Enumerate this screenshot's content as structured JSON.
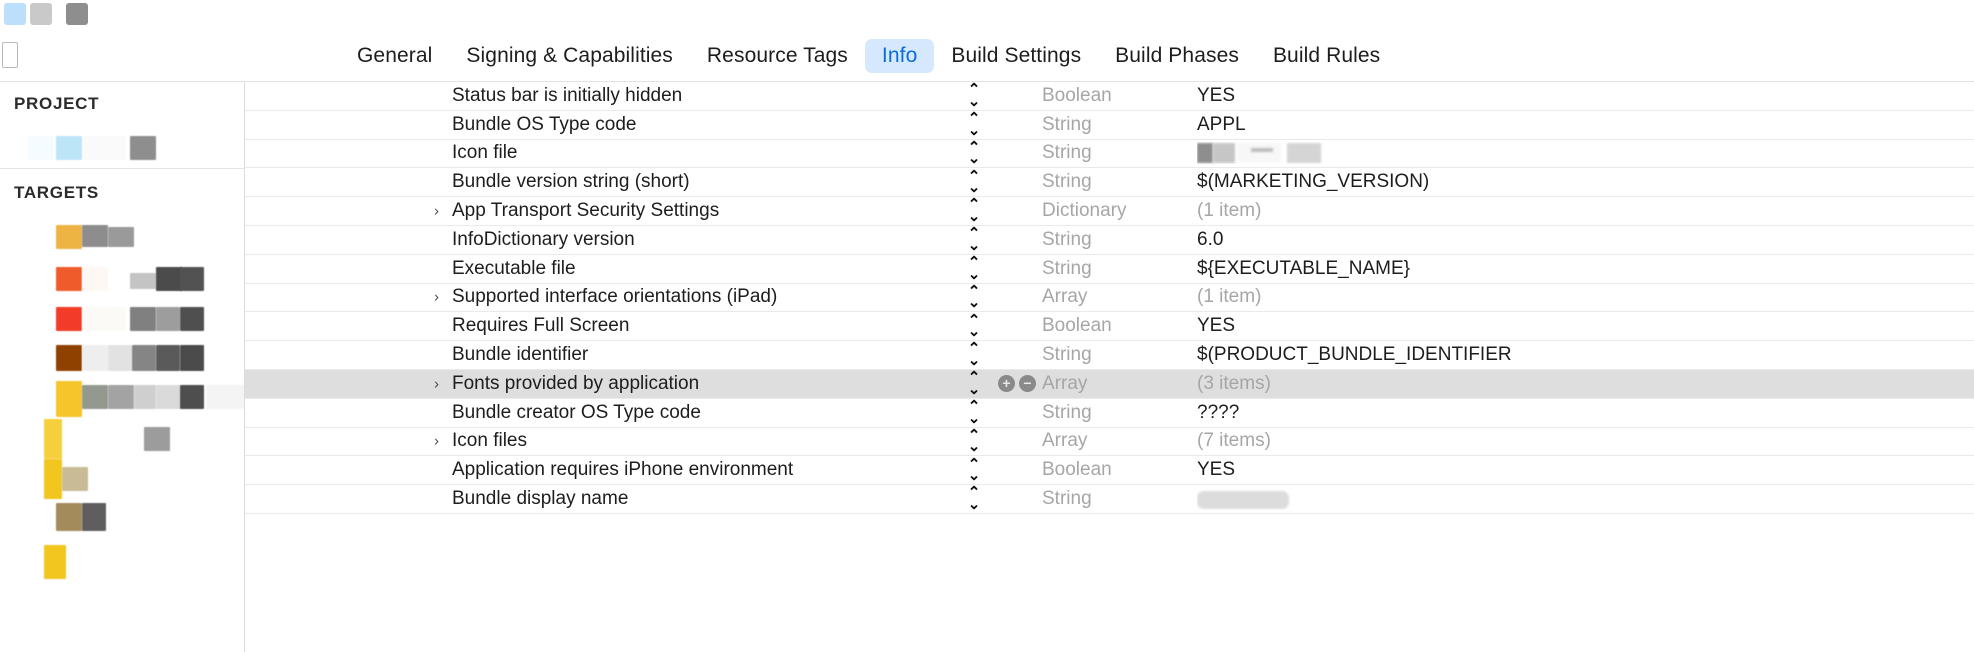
{
  "window": {
    "toolbar_swatches": [
      "#bcdffb",
      "#c9c9c9",
      "#8e8e8e"
    ]
  },
  "tabs": [
    {
      "label": "General",
      "active": false
    },
    {
      "label": "Signing & Capabilities",
      "active": false
    },
    {
      "label": "Resource Tags",
      "active": false
    },
    {
      "label": "Info",
      "active": true
    },
    {
      "label": "Build Settings",
      "active": false
    },
    {
      "label": "Build Phases",
      "active": false
    },
    {
      "label": "Build Rules",
      "active": false
    }
  ],
  "sidebar": {
    "project_header": "PROJECT",
    "targets_header": "TARGETS",
    "project_items": [
      {
        "name": "redacted-project-item",
        "accent": "#b9e2f7"
      }
    ],
    "target_items": [
      {
        "name": "redacted-target-item-1",
        "accent": "#eeb443"
      },
      {
        "name": "redacted-target-item-2",
        "accent": "#ef5b2b"
      },
      {
        "name": "redacted-target-item-3",
        "accent": "#f23c28"
      },
      {
        "name": "redacted-target-item-4",
        "accent": "#8f4100"
      },
      {
        "name": "redacted-target-item-5",
        "accent": "#f6c52a"
      },
      {
        "name": "redacted-target-item-6",
        "accent": "#f5d03c"
      },
      {
        "name": "redacted-target-item-7",
        "accent": "#c8a85c"
      },
      {
        "name": "redacted-target-item-8",
        "accent": "#f3c51f"
      }
    ]
  },
  "info_table": {
    "rows": [
      {
        "expandable": false,
        "key": "Status bar is initially hidden",
        "type": "Boolean",
        "value": "YES",
        "value_muted": false,
        "has_value_stepper": true,
        "selected": false,
        "redacted": false
      },
      {
        "expandable": false,
        "key": "Bundle OS Type code",
        "type": "String",
        "value": "APPL",
        "value_muted": false,
        "has_value_stepper": false,
        "selected": false,
        "redacted": false
      },
      {
        "expandable": false,
        "key": "Icon file",
        "type": "String",
        "value": "",
        "value_muted": false,
        "has_value_stepper": false,
        "selected": false,
        "redacted": true
      },
      {
        "expandable": false,
        "key": "Bundle version string (short)",
        "type": "String",
        "value": "$(MARKETING_VERSION)",
        "value_muted": false,
        "has_value_stepper": false,
        "selected": false,
        "redacted": false
      },
      {
        "expandable": true,
        "key": "App Transport Security Settings",
        "type": "Dictionary",
        "value": "(1 item)",
        "value_muted": true,
        "has_value_stepper": false,
        "selected": false,
        "redacted": false
      },
      {
        "expandable": false,
        "key": "InfoDictionary version",
        "type": "String",
        "value": "6.0",
        "value_muted": false,
        "has_value_stepper": false,
        "selected": false,
        "redacted": false
      },
      {
        "expandable": false,
        "key": "Executable file",
        "type": "String",
        "value": "${EXECUTABLE_NAME}",
        "value_muted": false,
        "has_value_stepper": false,
        "selected": false,
        "redacted": false
      },
      {
        "expandable": true,
        "key": "Supported interface orientations (iPad)",
        "type": "Array",
        "value": "(1 item)",
        "value_muted": true,
        "has_value_stepper": false,
        "selected": false,
        "redacted": false
      },
      {
        "expandable": false,
        "key": "Requires Full Screen",
        "type": "Boolean",
        "value": "YES",
        "value_muted": false,
        "has_value_stepper": true,
        "selected": false,
        "redacted": false
      },
      {
        "expandable": false,
        "key": "Bundle identifier",
        "type": "String",
        "value": "$(PRODUCT_BUNDLE_IDENTIFIER",
        "value_muted": false,
        "has_value_stepper": false,
        "selected": false,
        "redacted": false
      },
      {
        "expandable": true,
        "key": "Fonts provided by application",
        "type": "Array",
        "value": "(3 items)",
        "value_muted": true,
        "has_value_stepper": true,
        "selected": true,
        "redacted": false
      },
      {
        "expandable": false,
        "key": "Bundle creator OS Type code",
        "type": "String",
        "value": "????",
        "value_muted": false,
        "has_value_stepper": false,
        "selected": false,
        "redacted": false
      },
      {
        "expandable": true,
        "key": "Icon files",
        "type": "Array",
        "value": "(7 items)",
        "value_muted": true,
        "has_value_stepper": false,
        "selected": false,
        "redacted": false
      },
      {
        "expandable": false,
        "key": "Application requires iPhone environment",
        "type": "Boolean",
        "value": "YES",
        "value_muted": false,
        "has_value_stepper": true,
        "selected": false,
        "redacted": false
      },
      {
        "expandable": false,
        "key": "Bundle display name",
        "type": "String",
        "value": "",
        "value_muted": true,
        "has_value_stepper": false,
        "selected": false,
        "redacted": true
      }
    ],
    "icons": {
      "disclosure": "›",
      "stepper_up": "⌃",
      "stepper_down": "⌄",
      "add": "+",
      "remove": "−"
    }
  }
}
